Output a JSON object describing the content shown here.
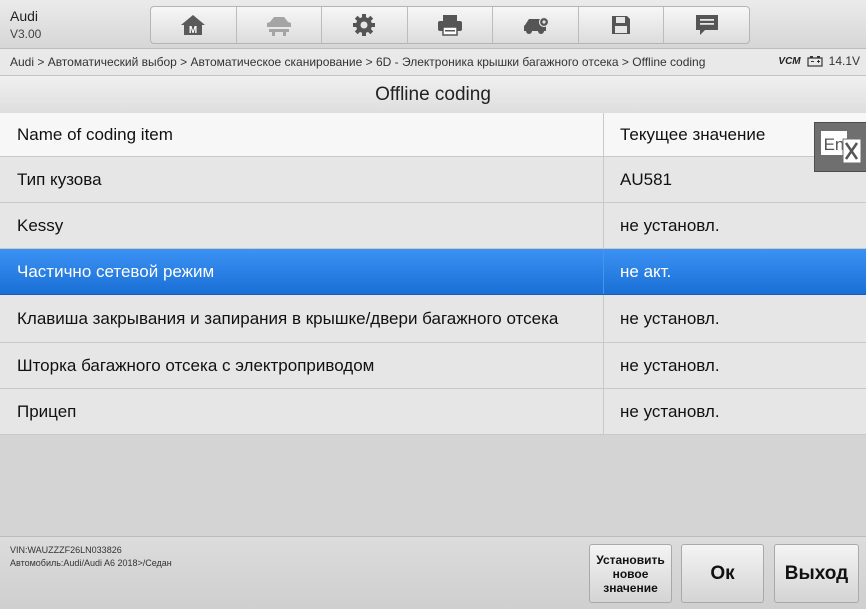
{
  "header": {
    "app_name": "Audi",
    "version": "V3.00",
    "toolbar": [
      {
        "name": "home-button",
        "icon": "home-m-icon"
      },
      {
        "name": "vehicle-lift-button",
        "icon": "car-lift-icon"
      },
      {
        "name": "settings-button",
        "icon": "gear-icon"
      },
      {
        "name": "print-button",
        "icon": "printer-icon"
      },
      {
        "name": "vehicle-service-button",
        "icon": "car-gear-icon"
      },
      {
        "name": "save-button",
        "icon": "floppy-disk-icon"
      },
      {
        "name": "messages-button",
        "icon": "chat-icon"
      }
    ]
  },
  "breadcrumb": "Audi > Автоматический выбор > Автоматическое сканирование > 6D - Электроника крышки багажного отсека > Offline coding",
  "status": {
    "vcm": "VCM",
    "voltage": "14.1V"
  },
  "page_title": "Offline coding",
  "table": {
    "headers": [
      "Name of coding item",
      "Текущее значение"
    ],
    "rows": [
      {
        "name": "Тип кузова",
        "value": "AU581"
      },
      {
        "name": "Kessy",
        "value": "не установл."
      },
      {
        "name": "Частично сетевой режим",
        "value": "не акт.",
        "selected": true
      },
      {
        "name": "Клавиша закрывания и запирания в крышке/двери багажного отсека",
        "value": "не установл."
      },
      {
        "name": "Шторка багажного отсека с электроприводом",
        "value": "не установл."
      },
      {
        "name": "Прицеп",
        "value": "не установл."
      }
    ]
  },
  "translate": {
    "label": "En"
  },
  "footer": {
    "vin": "VIN:WAUZZZF26LN033826",
    "car": "Автомобиль:Audi/Audi A6 2018>/Седан",
    "buttons": {
      "set_new": "Установить новое значение",
      "ok": "Ок",
      "exit": "Выход"
    }
  },
  "colors": {
    "selected_row": "#2a80e8",
    "background": "#d4d4d4"
  }
}
